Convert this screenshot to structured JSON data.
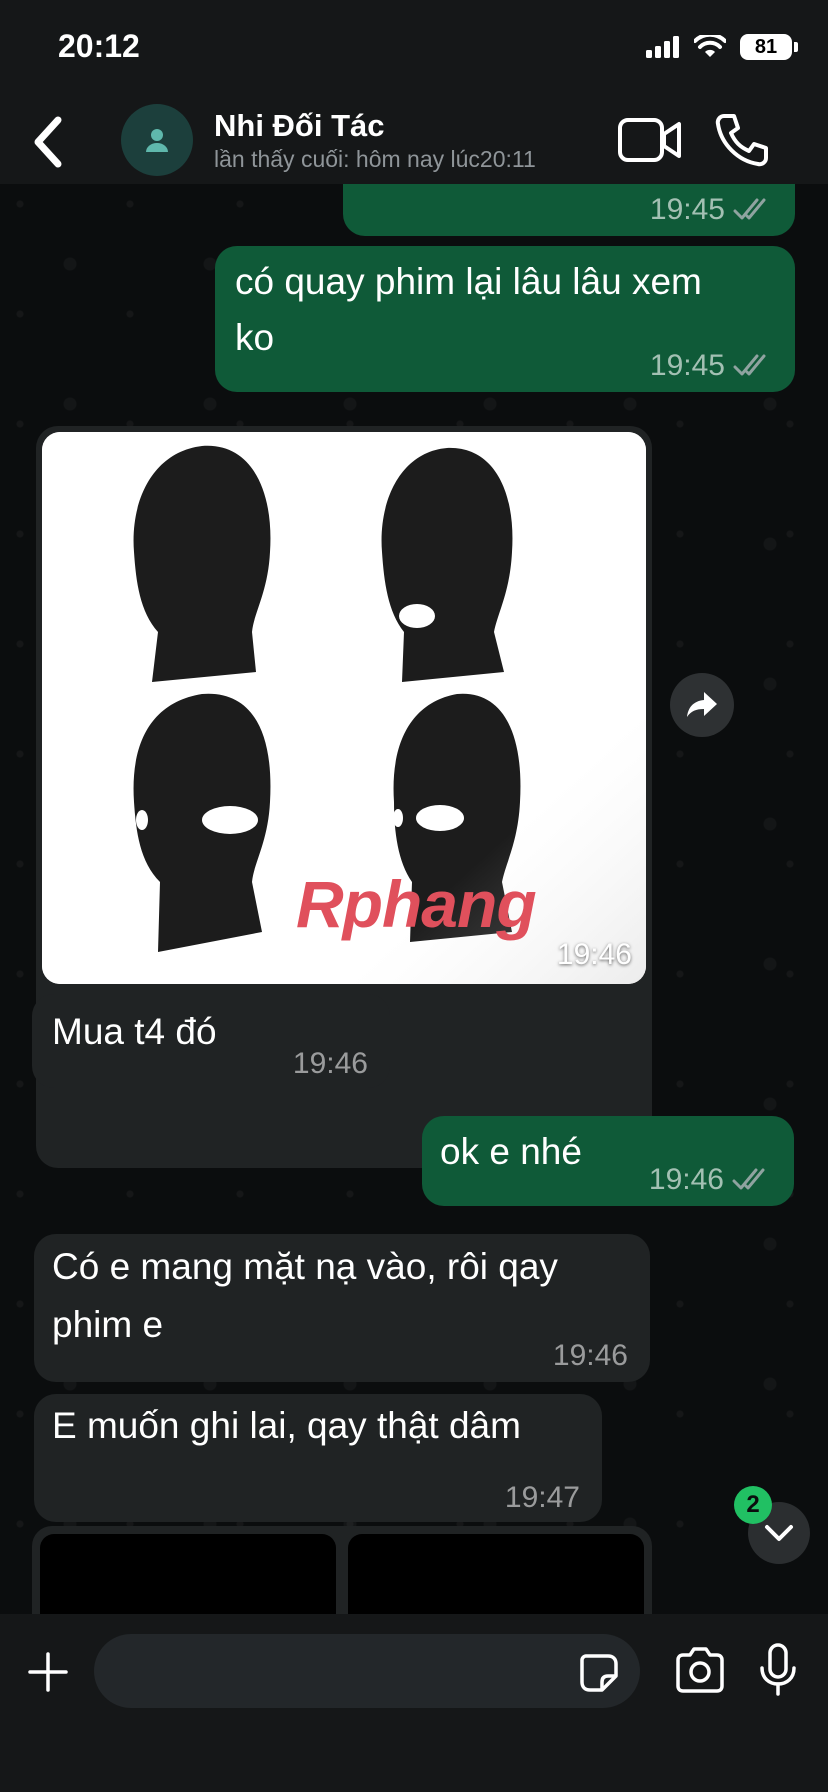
{
  "status_bar": {
    "time": "20:12",
    "battery": "81",
    "icons": [
      "signal-icon",
      "wifi-icon",
      "battery-icon"
    ]
  },
  "header": {
    "contact_name": "Nhi Đối Tác",
    "last_seen": "lần thấy cuối: hôm nay lúc20:11",
    "icons": [
      "back-icon",
      "avatar-person-icon",
      "video-call-icon",
      "phone-call-icon"
    ]
  },
  "messages": [
    {
      "direction": "out",
      "text": "",
      "time": "19:45",
      "status": "read"
    },
    {
      "direction": "out",
      "text": "có quay phim lại lâu lâu xem ko",
      "lines": [
        "có quay phim lại lâu lâu xem",
        "ko"
      ],
      "time": "19:45",
      "status": "read"
    },
    {
      "direction": "in",
      "type": "image",
      "watermark": "Rphang",
      "time": "19:46"
    },
    {
      "direction": "in",
      "text": "Mua t4 đó",
      "time": "19:46"
    },
    {
      "direction": "out",
      "text": "ok e nhé",
      "time": "19:46",
      "status": "read"
    },
    {
      "direction": "in",
      "text": "Có e mang mặt nạ vào, rôi qay phim e",
      "lines": [
        "Có e mang mặt nạ vào, rôi qay",
        "phim e"
      ],
      "time": "19:46"
    },
    {
      "direction": "in",
      "text": "E muốn ghi lai, qay thật dâm",
      "time": "19:47"
    },
    {
      "direction": "in",
      "type": "media-grid",
      "count_visible": 2
    }
  ],
  "scroll": {
    "unread_count": "2"
  },
  "composer": {
    "placeholder": "",
    "value": "",
    "icons": [
      "plus-icon",
      "sticker-icon",
      "camera-icon",
      "microphone-icon"
    ]
  },
  "colors": {
    "outgoing_bubble": "#0f5a38",
    "incoming_bubble": "#202324",
    "background": "#0b0d0e",
    "unread_badge": "#21c063",
    "read_ticks": "#8fa3a0"
  }
}
